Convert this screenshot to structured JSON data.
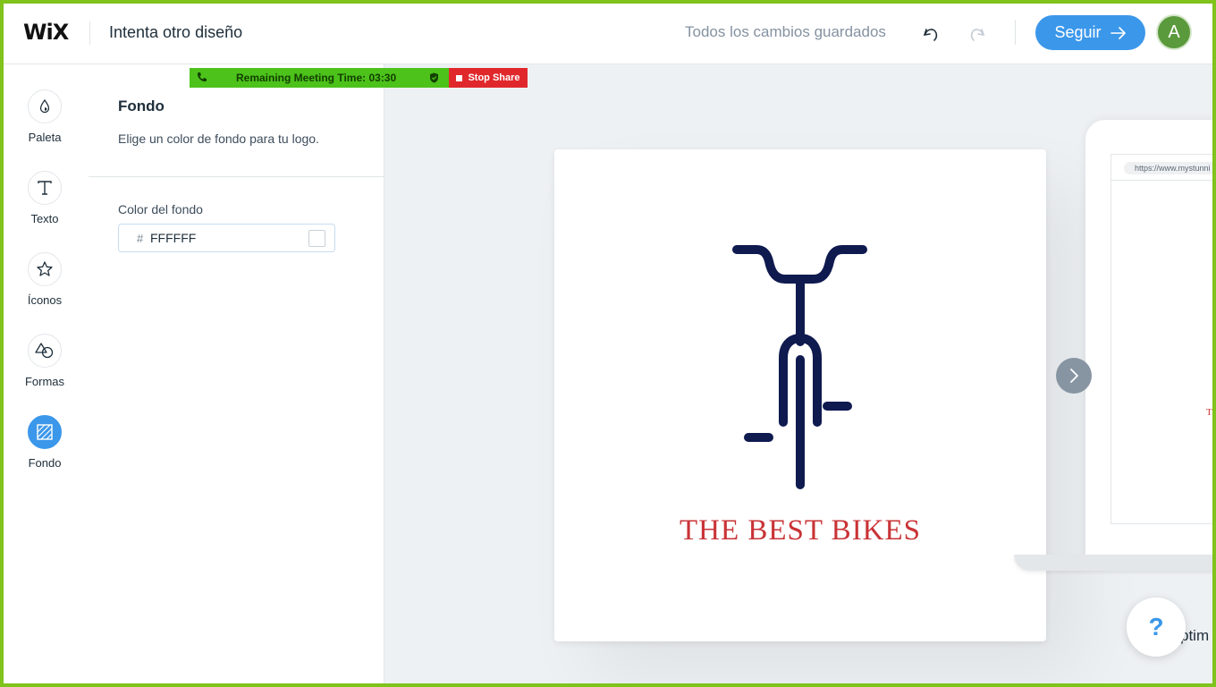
{
  "header": {
    "logo": "WiX",
    "title": "Intenta otro diseño",
    "saved_status": "Todos los cambios guardados",
    "seguir_label": "Seguir",
    "avatar_letter": "A"
  },
  "meeting_bar": {
    "text": "Remaining Meeting Time: 03:30",
    "stop_label": "Stop Share"
  },
  "rail": {
    "items": [
      {
        "label": "Paleta",
        "icon": "palette-drop-icon"
      },
      {
        "label": "Texto",
        "icon": "text-t-icon"
      },
      {
        "label": "Íconos",
        "icon": "star-icon"
      },
      {
        "label": "Formas",
        "icon": "shapes-icon"
      },
      {
        "label": "Fondo",
        "icon": "background-hatch-icon",
        "active": true
      }
    ]
  },
  "panel": {
    "title": "Fondo",
    "description": "Elige un color de fondo para tu logo.",
    "color_label": "Color del fondo",
    "hash": "#",
    "color_value": "FFFFFF"
  },
  "canvas": {
    "brand_text": "THE BEST BIKES",
    "preview_url": "https://www.mystunni",
    "preview_brand_fragment": "T",
    "optimize_fragment": "ptim",
    "help_label": "?"
  },
  "colors": {
    "accent": "#3b97ea",
    "brand_red": "#c93336",
    "bike_navy": "#0f1a4f",
    "meeting_green": "#4cc21a",
    "stop_red": "#e0282c",
    "frame_green": "#7fc31c"
  }
}
